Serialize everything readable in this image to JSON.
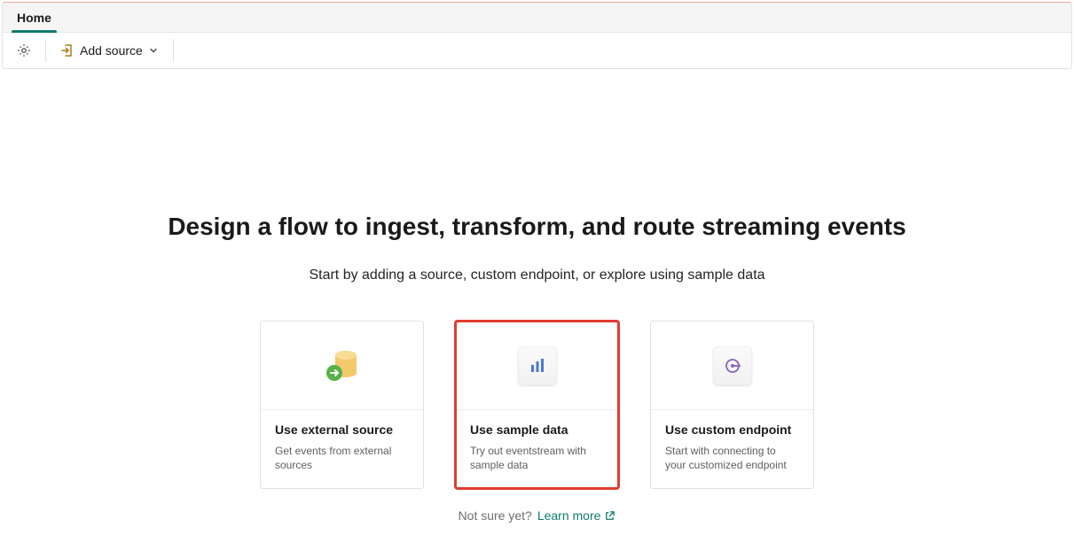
{
  "tabs": {
    "home": "Home"
  },
  "toolbar": {
    "add_source_label": "Add source"
  },
  "headline": "Design a flow to ingest, transform, and route streaming events",
  "subhead": "Start by adding a source, custom endpoint, or explore using sample data",
  "cards": {
    "external": {
      "title": "Use external source",
      "desc": "Get events from external sources"
    },
    "sample": {
      "title": "Use sample data",
      "desc": "Try out eventstream with sample data"
    },
    "custom": {
      "title": "Use custom endpoint",
      "desc": "Start with connecting to your customized endpoint"
    }
  },
  "footer": {
    "not_sure": "Not sure yet?",
    "learn_more": "Learn more"
  }
}
